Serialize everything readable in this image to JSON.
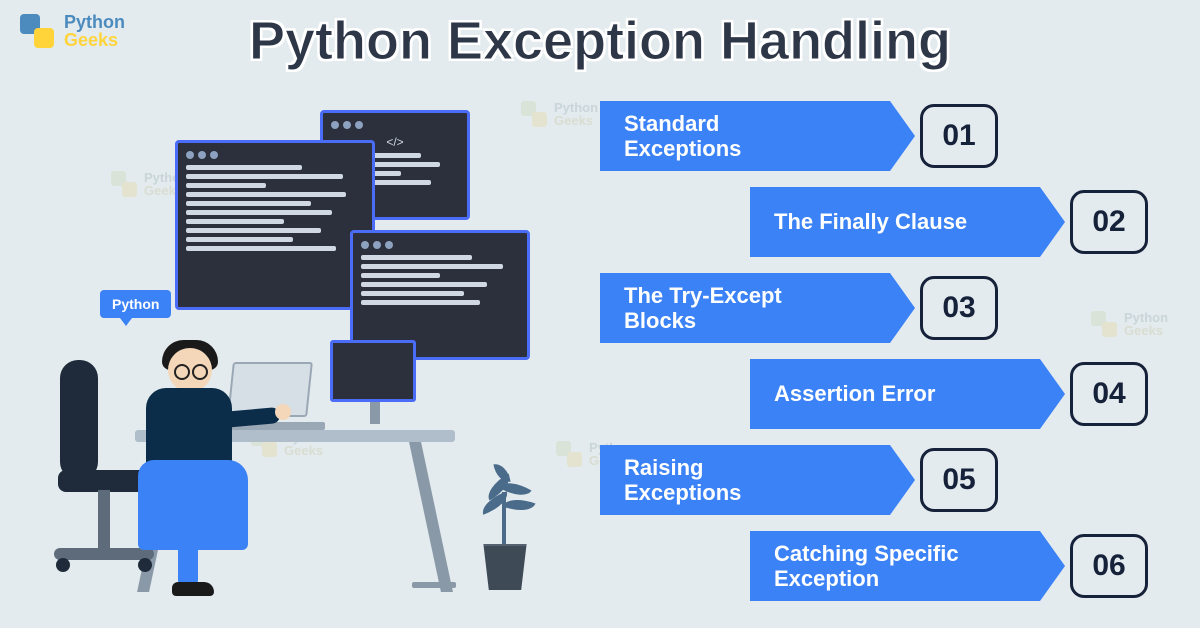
{
  "brand": {
    "line1": "Python",
    "line2": "Geeks"
  },
  "title": "Python Exception Handling",
  "speech": "Python",
  "watermark": {
    "line1": "Python",
    "line2": "Geeks"
  },
  "items": [
    {
      "label": "Standard\nExceptions",
      "num": "01",
      "align": "left"
    },
    {
      "label": "The Finally Clause",
      "num": "02",
      "align": "right"
    },
    {
      "label": "The Try-Except\nBlocks",
      "num": "03",
      "align": "left"
    },
    {
      "label": "Assertion Error",
      "num": "04",
      "align": "right"
    },
    {
      "label": "Raising\nExceptions",
      "num": "05",
      "align": "left"
    },
    {
      "label": "Catching Specific\nException",
      "num": "06",
      "align": "right"
    }
  ]
}
